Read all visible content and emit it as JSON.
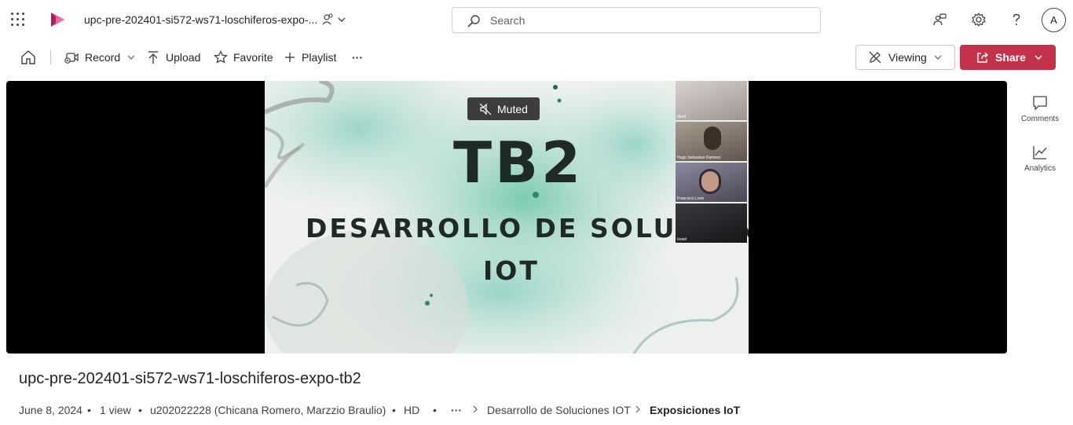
{
  "header": {
    "file_title": "upc-pre-202401-si572-ws71-loschiferos-expo-...",
    "search_placeholder": "Search",
    "avatar_initial": "A"
  },
  "toolbar": {
    "record_label": "Record",
    "upload_label": "Upload",
    "favorite_label": "Favorite",
    "playlist_label": "Playlist",
    "more_label": "···",
    "viewing_label": "Viewing",
    "share_label": "Share"
  },
  "player": {
    "muted_label": "Muted",
    "slide_title": "TB2",
    "slide_subtitle_line1": "DESARROLLO DE SOLUCION",
    "slide_subtitle_line2": "IOT",
    "tiles": [
      {
        "label": "Marti",
        "color": "#b9b1ad"
      },
      {
        "label": "Hugo Sebastian Ramirez",
        "color": "#7b6f66"
      },
      {
        "label": "Francisco Leon",
        "color": "#5d5a66"
      },
      {
        "label": "Israel",
        "color": "#2b2a2d"
      }
    ]
  },
  "rail": {
    "comments_label": "Comments",
    "analytics_label": "Analytics"
  },
  "details": {
    "title": "upc-pre-202401-si572-ws71-loschiferos-expo-tb2",
    "date": "June 8, 2024",
    "views": "1 view",
    "owner": "u202022228 (Chicana Romero, Marzzio Braulio)",
    "quality": "HD",
    "more": "···",
    "breadcrumb_parent": "Desarrollo de Soluciones IOT",
    "breadcrumb_current": "Exposiciones IoT",
    "separator": "•"
  },
  "colors": {
    "accent": "#c4314b",
    "logo": "#e03e7a"
  }
}
